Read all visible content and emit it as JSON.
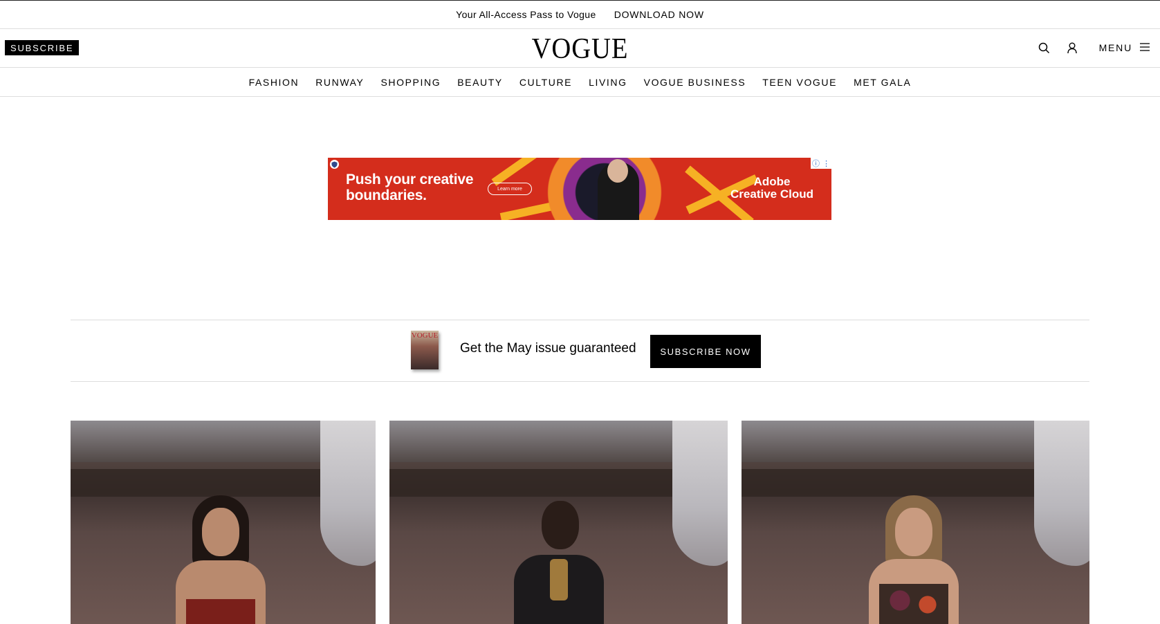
{
  "promo": {
    "text": "Your All-Access Pass to Vogue",
    "cta": "DOWNLOAD NOW"
  },
  "header": {
    "subscribe": "SUBSCRIBE",
    "logo": "VOGUE",
    "search_icon": "search-icon",
    "account_icon": "user-icon",
    "menu_label": "MENU",
    "menu_icon": "hamburger-icon"
  },
  "nav": {
    "items": [
      "FASHION",
      "RUNWAY",
      "SHOPPING",
      "BEAUTY",
      "CULTURE",
      "LIVING",
      "VOGUE BUSINESS",
      "TEEN VOGUE",
      "MET GALA"
    ]
  },
  "ad": {
    "headline_line1": "Push your creative",
    "headline_line2": "boundaries.",
    "cta": "Learn more",
    "brand_line1": "Adobe",
    "brand_line2": "Creative Cloud",
    "colors": {
      "background": "#d42d1c",
      "accent": "#f6b124"
    }
  },
  "subscription": {
    "magazine_title": "VOGUE",
    "text": "Get the May issue guaranteed",
    "cta": "SUBSCRIBE NOW"
  },
  "gallery": {
    "count": 3
  }
}
